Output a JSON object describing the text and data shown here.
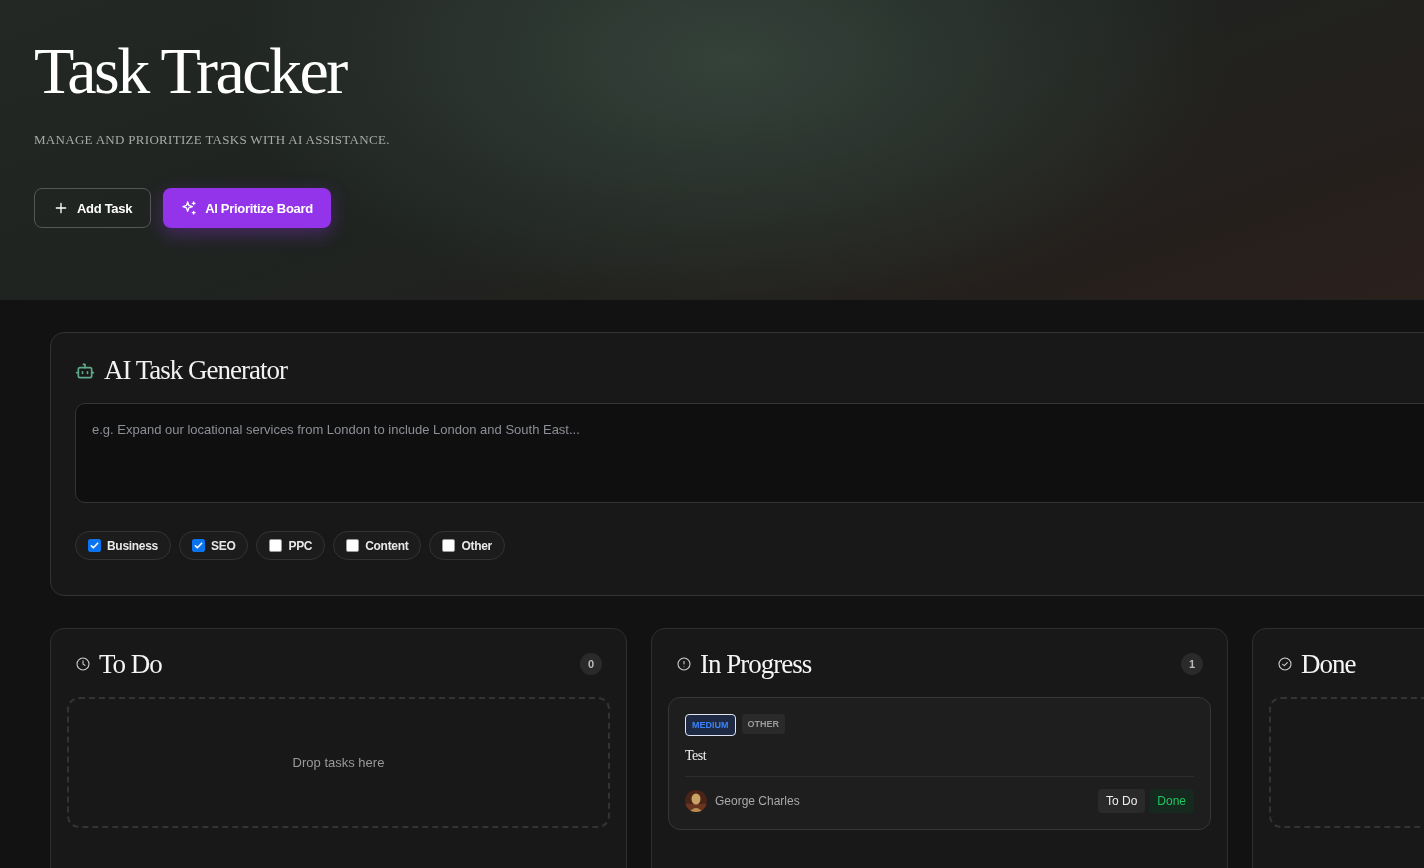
{
  "header": {
    "title": "Task Tracker",
    "subtitle": "MANAGE AND PRIORITIZE TASKS WITH AI ASSISTANCE.",
    "buttons": [
      {
        "label": "Add Task",
        "kind": "add"
      },
      {
        "label": "AI Prioritize Board",
        "kind": "ai"
      }
    ]
  },
  "generator": {
    "title": "AI Task Generator",
    "placeholder": "e.g. Expand our locational services from London to include London and South East...",
    "categories": [
      {
        "label": "Business",
        "checked": true
      },
      {
        "label": "SEO",
        "checked": true
      },
      {
        "label": "PPC",
        "checked": false
      },
      {
        "label": "Content",
        "checked": false
      },
      {
        "label": "Other",
        "checked": false
      }
    ]
  },
  "columns": [
    {
      "title": "To Do",
      "kind": "todo",
      "count": "0",
      "drop_text": "Drop tasks here"
    },
    {
      "title": "In Progress",
      "kind": "progress",
      "count": "1",
      "tasks": [
        {
          "tags": [
            {
              "label": "MEDIUM",
              "kind": "priority"
            },
            {
              "label": "OTHER",
              "kind": "category"
            }
          ],
          "title": "Test",
          "assignee": "George Charles",
          "actions": [
            {
              "label": "To Do",
              "kind": "neutral"
            },
            {
              "label": "Done",
              "kind": "success"
            }
          ]
        }
      ]
    },
    {
      "title": "Done",
      "kind": "done"
    }
  ]
}
